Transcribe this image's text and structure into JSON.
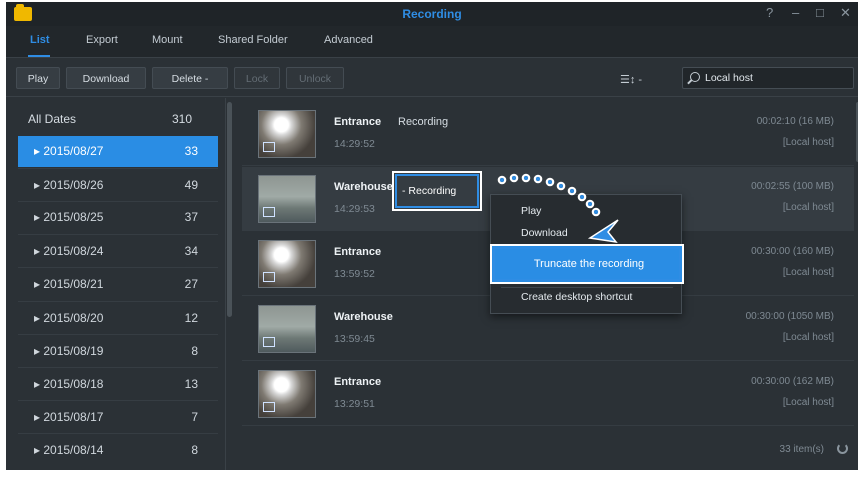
{
  "window": {
    "title": "Recording",
    "controls": [
      "?",
      "–",
      "□",
      "✕"
    ]
  },
  "tabs": [
    {
      "label": "List",
      "active": true
    },
    {
      "label": "Export",
      "active": false
    },
    {
      "label": "Mount",
      "active": false
    },
    {
      "label": "Shared Folder",
      "active": false
    },
    {
      "label": "Advanced",
      "active": false
    }
  ],
  "toolbar": {
    "play_label": "Play",
    "download_label": "Download",
    "delete_label": "Delete -",
    "lock_label": "Lock",
    "unlock_label": "Unlock",
    "view_label": "☰↕ -",
    "search_value": "Local host"
  },
  "sidebar": {
    "all_label": "All Dates",
    "all_count": "310",
    "dates": [
      {
        "label": "▸ 2015/08/27",
        "count": "33",
        "selected": true
      },
      {
        "label": "▸ 2015/08/26",
        "count": "49",
        "selected": false
      },
      {
        "label": "▸ 2015/08/25",
        "count": "37",
        "selected": false
      },
      {
        "label": "▸ 2015/08/24",
        "count": "34",
        "selected": false
      },
      {
        "label": "▸ 2015/08/21",
        "count": "27",
        "selected": false
      },
      {
        "label": "▸ 2015/08/20",
        "count": "12",
        "selected": false
      },
      {
        "label": "▸ 2015/08/19",
        "count": "8",
        "selected": false
      },
      {
        "label": "▸ 2015/08/18",
        "count": "13",
        "selected": false
      },
      {
        "label": "▸ 2015/08/17",
        "count": "7",
        "selected": false
      },
      {
        "label": "▸ 2015/08/14",
        "count": "8",
        "selected": false
      }
    ]
  },
  "recordings": [
    {
      "name": "Entrance",
      "tag": "Recording",
      "time": "14:29:52",
      "duration": "00:02:10 (16 MB)",
      "host": "[Local host]",
      "camera": "entrance"
    },
    {
      "name": "Warehouse",
      "tag": "- Recording",
      "time": "14:29:53",
      "duration": "00:02:55 (100 MB)",
      "host": "[Local host]",
      "camera": "warehouse"
    },
    {
      "name": "Entrance",
      "tag": "",
      "time": "13:59:52",
      "duration": "00:30:00 (160 MB)",
      "host": "[Local host]",
      "camera": "entrance"
    },
    {
      "name": "Warehouse",
      "tag": "",
      "time": "13:59:45",
      "duration": "00:30:00 (1050 MB)",
      "host": "[Local host]",
      "camera": "warehouse"
    },
    {
      "name": "Entrance",
      "tag": "",
      "time": "13:29:51",
      "duration": "00:30:00 (162 MB)",
      "host": "[Local host]",
      "camera": "entrance"
    }
  ],
  "context_menu": {
    "play": "Play",
    "download": "Download",
    "truncate": "Truncate the recording",
    "shortcut": "Create desktop shortcut"
  },
  "footer": {
    "items": "33 item(s)"
  },
  "colors": {
    "accent": "#2a8de4",
    "window_bg": "#2b3136",
    "titlebar": "#1f2428"
  }
}
